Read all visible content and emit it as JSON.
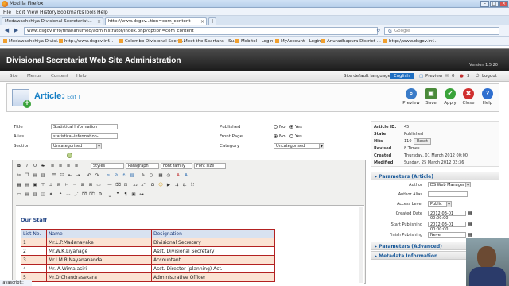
{
  "browser": {
    "window_title": "Mozilla Firefox",
    "menu": [
      "File",
      "Edit",
      "View",
      "History",
      "Bookmarks",
      "Tools",
      "Help"
    ],
    "tabs": [
      {
        "label": "Medawachchiya Divisional Secretariat..."
      },
      {
        "label": "http://www.dsgov...tion=com_content"
      }
    ],
    "url": "www.dsgov.info/final/anumed/administrator/index.php?option=com_content",
    "search_placeholder": "Google",
    "bookmarks": [
      "Medawachchiya Divisi...",
      "http://www.dsgov.inf...",
      "Colombo Divisional Secre...",
      "Meet the Spartans - Su...",
      "Mobitel - Login",
      "MyAccount - Login",
      "Anuradhapura District ...",
      "http://www.dsgov.inf..."
    ],
    "status_text": "javascript:;"
  },
  "admin": {
    "site_title": "Divisional Secretariat Web Site Administration",
    "version": "Version 1.5.20",
    "menu": [
      "Site",
      "Menus",
      "Content",
      "Help"
    ],
    "language_label": "Site default language:",
    "language_value": "English",
    "preview_label": "Preview",
    "msg_count": "0",
    "users_count": "3",
    "logout_label": "Logout"
  },
  "toolbar": {
    "title": "Article:",
    "edit_label": "[ Edit ]",
    "buttons": [
      {
        "label": "Preview",
        "color": "#3a7bc8",
        "glyph": "🔍"
      },
      {
        "label": "Save",
        "color": "#4a8a3a",
        "glyph": "💾"
      },
      {
        "label": "Apply",
        "color": "#3aa33a",
        "glyph": "✔"
      },
      {
        "label": "Close",
        "color": "#d03030",
        "glyph": "✖"
      },
      {
        "label": "Help",
        "color": "#2f6fcf",
        "glyph": "?"
      }
    ]
  },
  "form": {
    "title_label": "Title",
    "title_value": "Statistical Information",
    "alias_label": "Alias",
    "alias_value": "statistical-information-",
    "section_label": "Section",
    "section_value": "Uncategorised",
    "published_label": "Published",
    "frontpage_label": "Front Page",
    "category_label": "Category",
    "category_value": "Uncategorised",
    "no_label": "No",
    "yes_label": "Yes"
  },
  "editor": {
    "styles": "Styles",
    "paragraph": "Paragraph",
    "font_family": "Font family",
    "font_size": "Font size",
    "heading": "Our Staff",
    "columns": [
      "List No.",
      "Name",
      "Designation"
    ],
    "rows": [
      [
        "1",
        "Mr.L.P.Madanayake",
        "Divisional Secretary"
      ],
      [
        "2",
        "Mr.W.K.Liyanage",
        "Asst. Divisional Secretary"
      ],
      [
        "3",
        "Mr.I.M.R.Nayanananda",
        "Accountant"
      ],
      [
        "4",
        "Mr. A.Wimalasiri",
        "Asst. Director (planning) Act."
      ],
      [
        "5",
        "Mr.D.Chandrasekara",
        "Administrative Officer"
      ]
    ]
  },
  "info": {
    "article_id_label": "Article ID:",
    "article_id": "45",
    "state_label": "State",
    "state": "Published",
    "hits_label": "Hits",
    "hits": "110",
    "reset_label": "Reset",
    "revised_label": "Revised",
    "revised": "8 Times",
    "created_label": "Created",
    "created": "Thursday, 01 March 2012 00:00",
    "modified_label": "Modified",
    "modified": "Sunday, 25 March 2012 03:36"
  },
  "params": {
    "header": "Parameters (Article)",
    "author_label": "Author",
    "author_value": "DS Web Manager",
    "author_alias_label": "Author Alias",
    "access_label": "Access Level",
    "access_value": "Public",
    "created_date_label": "Created Date",
    "created_date": "2012-03-01 00:00:00",
    "start_pub_label": "Start Publishing",
    "start_pub": "2012-03-01 00:00:00",
    "finish_pub_label": "Finish Publishing",
    "finish_pub": "Never",
    "advanced_header": "Parameters (Advanced)",
    "metadata_header": "Metadata Information"
  }
}
